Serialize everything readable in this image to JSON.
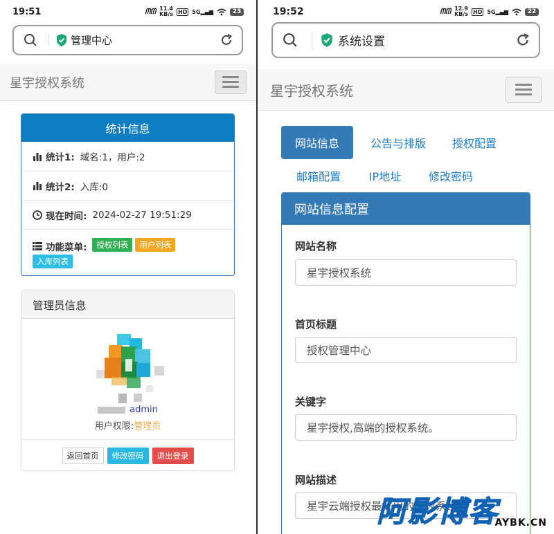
{
  "left": {
    "status": {
      "time": "19:51",
      "net_speed": "11.4",
      "net_unit": "KB/s",
      "battery": "23"
    },
    "url": {
      "title": "管理中心"
    },
    "navbar": {
      "brand": "星宇授权系统"
    },
    "stats": {
      "header": "统计信息",
      "row1_label": "统计1:",
      "row1_value": "域名:1，用户:2",
      "row2_label": "统计2:",
      "row2_value": "入库:0",
      "row3_label": "现在时间:",
      "row3_value": "2024-02-27 19:51:29",
      "menu_label": "功能菜单:",
      "menu_items": [
        "授权列表",
        "用户列表",
        "入库列表"
      ]
    },
    "admin": {
      "header": "管理员信息",
      "name": "admin",
      "role_label": "用户权限:",
      "role_value": "管理员",
      "buttons": [
        "返回首页",
        "修改密码",
        "退出登录"
      ]
    }
  },
  "right": {
    "status": {
      "time": "19:52",
      "net_speed": "12.9",
      "net_unit": "KB/s",
      "battery": "22"
    },
    "url": {
      "title": "系统设置"
    },
    "navbar": {
      "brand": "星宇授权系统"
    },
    "tabs": [
      "网站信息",
      "公告与排版",
      "授权配置",
      "邮箱配置",
      "IP地址",
      "修改密码"
    ],
    "panel": {
      "header": "网站信息配置",
      "fields": [
        {
          "label": "网站名称",
          "value": "星宇授权系统"
        },
        {
          "label": "首页标题",
          "value": "授权管理中心"
        },
        {
          "label": "关键字",
          "value": "星宇授权,高端的授权系统。"
        },
        {
          "label": "网站描述",
          "value": "星宇云端授权最好用的授权系统"
        }
      ]
    }
  },
  "watermark": {
    "text": "阿影博客",
    "sub": "AYBK.CN"
  },
  "colors": {
    "primary": "#337ab7",
    "header_blue": "#0f7dc2",
    "success": "#2fb053",
    "warning": "#f5a623",
    "info": "#2bbfe6",
    "danger": "#e24c4b",
    "watermark": "#1677d6"
  }
}
